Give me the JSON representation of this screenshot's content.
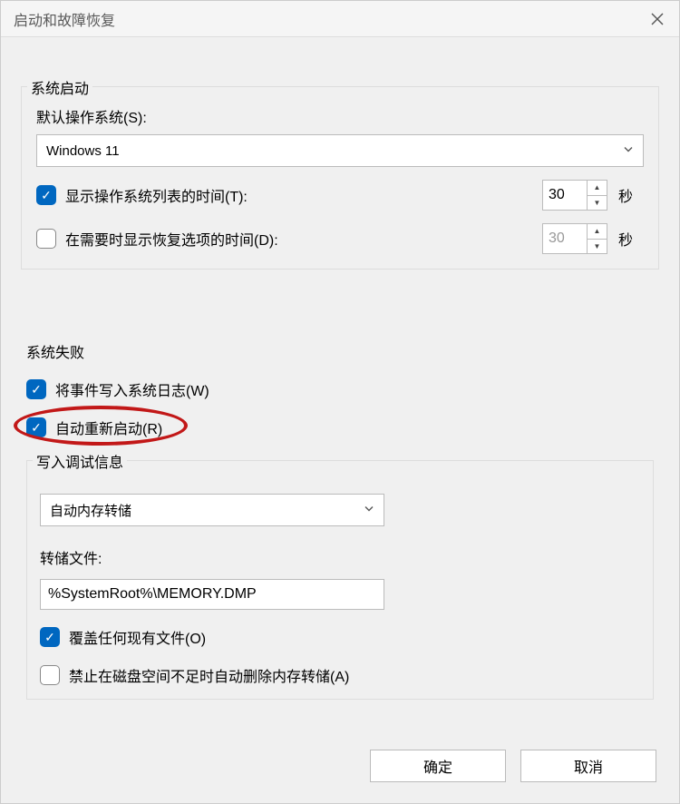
{
  "dialog": {
    "title": "启动和故障恢复"
  },
  "system_startup": {
    "legend": "系统启动",
    "default_os_label": "默认操作系统(S):",
    "default_os_value": "Windows 11",
    "display_os_list": {
      "checked": true,
      "label": "显示操作系统列表的时间(T):",
      "value": "30",
      "unit": "秒"
    },
    "display_recovery": {
      "checked": false,
      "label": "在需要时显示恢复选项的时间(D):",
      "value": "30",
      "unit": "秒"
    }
  },
  "system_failure": {
    "legend": "系统失败",
    "write_event": {
      "checked": true,
      "label": "将事件写入系统日志(W)"
    },
    "auto_restart": {
      "checked": true,
      "label": "自动重新启动(R)"
    },
    "debug_info": {
      "legend": "写入调试信息",
      "dump_type": "自动内存转储",
      "dump_file_label": "转储文件:",
      "dump_file_value": "%SystemRoot%\\MEMORY.DMP",
      "overwrite": {
        "checked": true,
        "label": "覆盖任何现有文件(O)"
      },
      "no_autodelete": {
        "checked": false,
        "label": "禁止在磁盘空间不足时自动删除内存转储(A)"
      }
    }
  },
  "buttons": {
    "ok": "确定",
    "cancel": "取消"
  }
}
